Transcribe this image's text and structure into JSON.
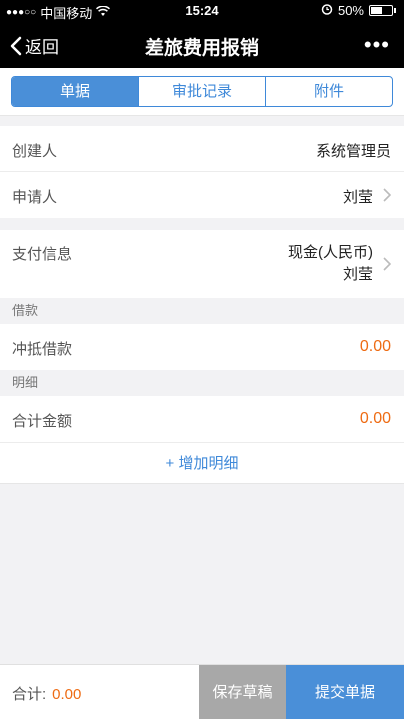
{
  "status_bar": {
    "signal_dots": "●●●○○",
    "carrier": "中国移动",
    "wifi_icon": "wifi-icon",
    "time": "15:24",
    "alarm_icon": "alarm-icon",
    "battery_percent": "50%"
  },
  "nav": {
    "back_label": "返回",
    "title": "差旅费用报销",
    "more_label": "•••"
  },
  "tabs": [
    {
      "label": "单据",
      "active": true
    },
    {
      "label": "审批记录",
      "active": false
    },
    {
      "label": "附件",
      "active": false
    }
  ],
  "form": {
    "creator": {
      "label": "创建人",
      "value": "系统管理员"
    },
    "applicant": {
      "label": "申请人",
      "value": "刘莹"
    },
    "payment": {
      "label": "支付信息",
      "value_line1": "现金(人民币)",
      "value_line2": "刘莹"
    }
  },
  "loan_section": {
    "header": "借款",
    "offset": {
      "label": "冲抵借款",
      "value": "0.00"
    }
  },
  "detail_section": {
    "header": "明细",
    "total": {
      "label": "合计金额",
      "value": "0.00"
    },
    "add_label": "+ 增加明细"
  },
  "footer": {
    "total_label": "合计:",
    "total_value": "0.00",
    "save_draft_label": "保存草稿",
    "submit_label": "提交单据"
  },
  "colors": {
    "accent": "#4a8fd8",
    "amount": "#ee6b13",
    "draft_button": "#a8a8a8"
  }
}
